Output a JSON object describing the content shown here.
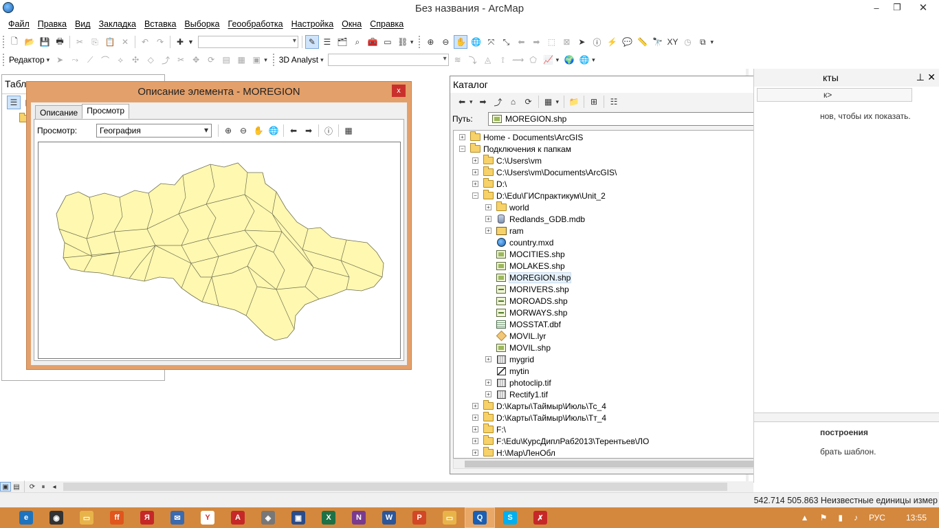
{
  "window": {
    "title": "Без названия - ArcMap",
    "minimize": "–",
    "restore": "❐",
    "close": "✕"
  },
  "menu": [
    "Файл",
    "Правка",
    "Вид",
    "Закладка",
    "Вставка",
    "Выборка",
    "Геообработка",
    "Настройка",
    "Окна",
    "Справка"
  ],
  "toolbar2": {
    "editor_label": "Редактор",
    "analyst_label": "3D Analyst"
  },
  "toc": {
    "title_fragment": "Табл"
  },
  "dialog": {
    "title": "Описание элемента - MOREGION",
    "close": "x",
    "tabs": [
      "Описание",
      "Просмотр"
    ],
    "preview_label": "Просмотр:",
    "preview_mode": "География"
  },
  "catalog": {
    "title": "Каталог",
    "path_label": "Путь:",
    "path_value": "MOREGION.shp",
    "items": [
      {
        "label": "Home - Documents\\ArcGIS",
        "icon": "folder-icon",
        "expander": "+",
        "indent": 0
      },
      {
        "label": "Подключения к  папкам",
        "icon": "folder-icon",
        "expander": "−",
        "indent": 0
      },
      {
        "label": "C:\\Users\\vm",
        "icon": "folder-icon",
        "expander": "+",
        "indent": 1
      },
      {
        "label": "C:\\Users\\vm\\Documents\\ArcGIS\\",
        "icon": "folder-icon",
        "expander": "+",
        "indent": 1
      },
      {
        "label": "D:\\",
        "icon": "folder-icon",
        "expander": "+",
        "indent": 1
      },
      {
        "label": "D:\\Edu\\ГИСпрактикум\\Unit_2",
        "icon": "folder-icon",
        "expander": "−",
        "indent": 1
      },
      {
        "label": "world",
        "icon": "folder-icon",
        "expander": "+",
        "indent": 2
      },
      {
        "label": "Redlands_GDB.mdb",
        "icon": "database-icon",
        "expander": "+",
        "indent": 2
      },
      {
        "label": "ram",
        "icon": "raster-folder-icon",
        "expander": "+",
        "indent": 2
      },
      {
        "label": "country.mxd",
        "icon": "map-document-icon",
        "expander": "",
        "indent": 2
      },
      {
        "label": "MOCITIES.shp",
        "icon": "shapefile-icon",
        "expander": "",
        "indent": 2
      },
      {
        "label": "MOLAKES.shp",
        "icon": "shapefile-icon",
        "expander": "",
        "indent": 2
      },
      {
        "label": "MOREGION.shp",
        "icon": "shapefile-icon",
        "expander": "",
        "indent": 2,
        "selected": true
      },
      {
        "label": "MORIVERS.shp",
        "icon": "line-shapefile-icon",
        "expander": "",
        "indent": 2
      },
      {
        "label": "MOROADS.shp",
        "icon": "line-shapefile-icon",
        "expander": "",
        "indent": 2
      },
      {
        "label": "MORWAYS.shp",
        "icon": "line-shapefile-icon",
        "expander": "",
        "indent": 2
      },
      {
        "label": "MOSSTAT.dbf",
        "icon": "table-icon",
        "expander": "",
        "indent": 2
      },
      {
        "label": "MOVIL.lyr",
        "icon": "layer-file-icon",
        "expander": "",
        "indent": 2
      },
      {
        "label": "MOVIL.shp",
        "icon": "shapefile-icon",
        "expander": "",
        "indent": 2
      },
      {
        "label": "mygrid",
        "icon": "grid-icon",
        "expander": "+",
        "indent": 2
      },
      {
        "label": "mytin",
        "icon": "tin-icon",
        "expander": "",
        "indent": 2
      },
      {
        "label": "photoclip.tif",
        "icon": "grid-icon",
        "expander": "+",
        "indent": 2
      },
      {
        "label": "Rectify1.tif",
        "icon": "grid-icon",
        "expander": "+",
        "indent": 2
      },
      {
        "label": "D:\\Карты\\Таймыр\\Июль\\Тс_4",
        "icon": "folder-icon",
        "expander": "+",
        "indent": 1
      },
      {
        "label": "D:\\Карты\\Таймыр\\Июль\\Тт_4",
        "icon": "folder-icon",
        "expander": "+",
        "indent": 1
      },
      {
        "label": "F:\\",
        "icon": "folder-icon",
        "expander": "+",
        "indent": 1
      },
      {
        "label": "F:\\Edu\\КурсДиплРаб2013\\Терентьев\\ЛО",
        "icon": "folder-icon",
        "expander": "+",
        "indent": 1
      },
      {
        "label": "H:\\Map\\ЛенОбл",
        "icon": "folder-icon",
        "expander": "+",
        "indent": 1
      }
    ]
  },
  "right_panel": {
    "title_fragment": "кты",
    "combo_fragment": "к>",
    "hint_fragment": "нов, чтобы их показать.",
    "section_fragment": "построения",
    "section_hint_fragment": "брать шаблон."
  },
  "status": {
    "coordinates": "542.714  505.863 Неизвестные единицы измер"
  },
  "taskbar": {
    "apps": [
      {
        "name": "ie-icon",
        "color": "#1e73be",
        "glyph": "e"
      },
      {
        "name": "media-icon",
        "color": "#333333",
        "glyph": "◉"
      },
      {
        "name": "explorer-icon",
        "color": "#e8b44a",
        "glyph": "▭"
      },
      {
        "name": "firefox-icon",
        "color": "#e0561d",
        "glyph": "ff"
      },
      {
        "name": "yandex-icon",
        "color": "#c62828",
        "glyph": "Я"
      },
      {
        "name": "mail-icon",
        "color": "#3a6ab0",
        "glyph": "✉"
      },
      {
        "name": "yandex-browser-icon",
        "color": "#ffffff",
        "glyph": "Y"
      },
      {
        "name": "acrobat-icon",
        "color": "#c62828",
        "glyph": "A"
      },
      {
        "name": "app-icon",
        "color": "#777777",
        "glyph": "◈"
      },
      {
        "name": "save-app-icon",
        "color": "#2a4c8a",
        "glyph": "▣"
      },
      {
        "name": "excel-icon",
        "color": "#1e7145",
        "glyph": "X"
      },
      {
        "name": "onenote-icon",
        "color": "#7a3b8f",
        "glyph": "N"
      },
      {
        "name": "word-icon",
        "color": "#2b579a",
        "glyph": "W"
      },
      {
        "name": "powerpoint-icon",
        "color": "#d24726",
        "glyph": "P"
      },
      {
        "name": "folder-app-icon",
        "color": "#e8b44a",
        "glyph": "▭"
      },
      {
        "name": "arcmap-icon",
        "color": "#1a5fb4",
        "glyph": "Q",
        "active": true
      },
      {
        "name": "skype-icon",
        "color": "#00aff0",
        "glyph": "S"
      },
      {
        "name": "pdf-tool-icon",
        "color": "#c62828",
        "glyph": "✗"
      }
    ],
    "language": "РУС",
    "time": "13:55",
    "tray_arrow": "▲",
    "net_icon": "▮",
    "volume_icon": "♪",
    "flag_icon": "⚑"
  },
  "colors": {
    "taskbar": "#d3883e",
    "dialog_frame": "#e4a06a",
    "region_fill": "#fff8b0",
    "region_stroke": "#6e6e50"
  }
}
